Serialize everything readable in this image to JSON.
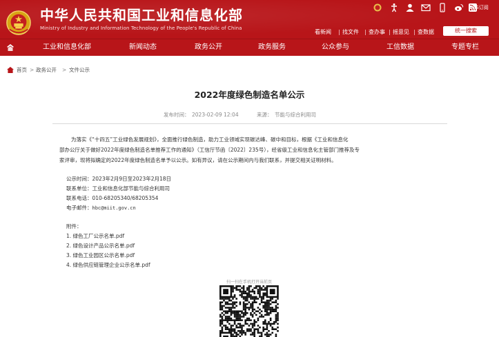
{
  "header": {
    "title": "中华人民共和国工业和信息化部",
    "subtitle": "Ministry of Industry and Information Technology of the People's Republic of China",
    "rss_label": "RSS订阅",
    "tool_icons": [
      "emblem-mini-icon",
      "accessibility-icon",
      "user-icon",
      "mail-icon",
      "mobile-icon",
      "weibo-icon",
      "rss-icon"
    ],
    "quick_links": [
      "看新闻",
      "找文件",
      "查办事",
      "摇意见",
      "查数据"
    ],
    "login_label": "统一搜索",
    "brand_color": "#b81519"
  },
  "nav": {
    "items": [
      "工业和信息化部",
      "新闻动态",
      "政务公开",
      "政务服务",
      "公众参与",
      "工信数据",
      "专题专栏"
    ]
  },
  "breadcrumb": {
    "items": [
      "首页",
      "政务公开",
      "文件公示"
    ],
    "separator": ">"
  },
  "article": {
    "title": "2022年度绿色制造名单公示",
    "publish_label": "发布时间：",
    "publish_date": "2023-02-09 12:04",
    "source_label": "来源：",
    "source": "节能与综合利用司",
    "paragraph_lines": [
      "为落实《“十四五”工业绿色发展规划》，全面推行绿色制造，助力工业领域实现碳达峰、碳中和目标，根据《工业和信息化",
      "部办公厅关于做好2022年度绿色制造名单推荐工作的通知》（工信厅节函〔2022〕235号），经省级工业和信息化主管部门推荐及专",
      "家评审，现将拟确定的2022年度绿色制造名单予以公示。如有异议，请在公示期间内与我们联系，并提交相关证明材料。"
    ],
    "info": {
      "period": "公示时间：2023年2月9日至2023年2月18日",
      "unit": "联系单位：工业和信息化部节能与综合利用司",
      "phone": "联系电话：010-68205340/68205354",
      "email_label": "电子邮件：",
      "email": "hbc@miit.gov.cn"
    },
    "attachments_label": "附件：",
    "attachments": [
      "1. 绿色工厂公示名单.pdf",
      "2. 绿色设计产品公示名单.pdf",
      "3. 绿色工业园区公示名单.pdf",
      "4. 绿色供应链管理企业公示名单.pdf"
    ],
    "qr_caption": "扫一扫在手机打开当前页"
  }
}
